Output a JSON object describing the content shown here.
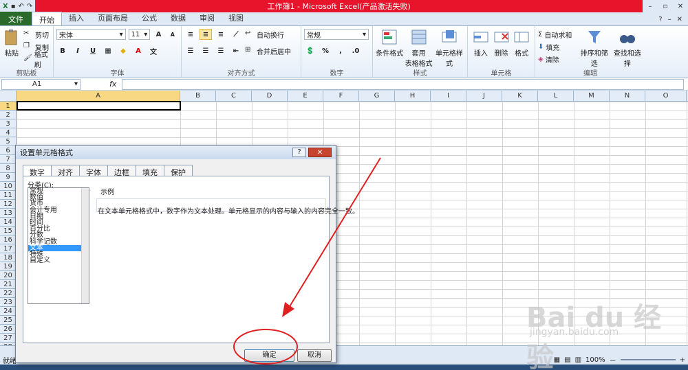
{
  "window": {
    "title": "工作簿1 - Microsoft Excel(产品激活失败)",
    "qa_icons": [
      "excel-icon",
      "save-icon",
      "undo-icon",
      "redo-icon"
    ]
  },
  "tabs": {
    "file": "文件",
    "items": [
      "开始",
      "插入",
      "页面布局",
      "公式",
      "数据",
      "审阅",
      "视图"
    ]
  },
  "ribbon": {
    "clipboard": {
      "paste": "粘贴",
      "cut": "剪切",
      "copy": "复制",
      "format_painter": "格式刷",
      "label": "剪贴板"
    },
    "font": {
      "name": "宋体",
      "size": "11",
      "bold": "B",
      "italic": "I",
      "underline": "U",
      "label": "字体",
      "grow": "A",
      "shrink": "A",
      "font_color": "A",
      "wen": "文"
    },
    "alignment": {
      "wrap": "自动换行",
      "merge": "合并后居中",
      "label": "对齐方式"
    },
    "number": {
      "format": "常规",
      "percent": "%",
      "comma": ",",
      "label": "数字"
    },
    "styles": {
      "conditional": "条件格式",
      "table_l1": "套用",
      "table_l2": "表格格式",
      "cell_styles": "单元格样式",
      "label": "样式"
    },
    "cells": {
      "insert": "插入",
      "delete": "删除",
      "format": "格式",
      "label": "单元格"
    },
    "editing": {
      "autosum": "自动求和",
      "fill": "填充",
      "clear": "清除",
      "sort": "排序和筛选",
      "find": "查找和选择",
      "label": "编辑"
    }
  },
  "formula_bar": {
    "name_box": "A1",
    "fx": "fx",
    "value": ""
  },
  "sheet": {
    "columns": [
      "A",
      "B",
      "C",
      "D",
      "E",
      "F",
      "G",
      "H",
      "I",
      "J",
      "K",
      "L",
      "M",
      "N",
      "O"
    ],
    "rows": [
      "1",
      "2",
      "3",
      "4",
      "5",
      "6",
      "7",
      "8",
      "9",
      "10",
      "11",
      "12",
      "13",
      "14",
      "15",
      "16",
      "17",
      "18",
      "19",
      "20",
      "21",
      "22",
      "23",
      "24",
      "25",
      "26",
      "27",
      "28"
    ],
    "active_col": "A",
    "active_row": "1"
  },
  "status": {
    "ready": "就绪",
    "zoom": "100%",
    "zoom_minus": "－",
    "zoom_plus": "+"
  },
  "dialog": {
    "title": "设置单元格格式",
    "help": "?",
    "close": "✕",
    "tabs": [
      "数字",
      "对齐",
      "字体",
      "边框",
      "填充",
      "保护"
    ],
    "category_label": "分类(C):",
    "categories": [
      "常规",
      "数值",
      "货币",
      "会计专用",
      "日期",
      "时间",
      "百分比",
      "分数",
      "科学记数",
      "文本",
      "特殊",
      "自定义"
    ],
    "selected_category": "文本",
    "sample_label": "示例",
    "description": "在文本单元格格式中，数字作为文本处理。单元格显示的内容与输入的内容完全一致。",
    "ok": "确定",
    "cancel": "取消"
  },
  "watermark": {
    "brand": "Bai du 经验",
    "url": "jingyan.baidu.com"
  },
  "colors": {
    "title_bar": "#e8142c",
    "annotation": "#e02020",
    "selection": "#3399ff"
  }
}
